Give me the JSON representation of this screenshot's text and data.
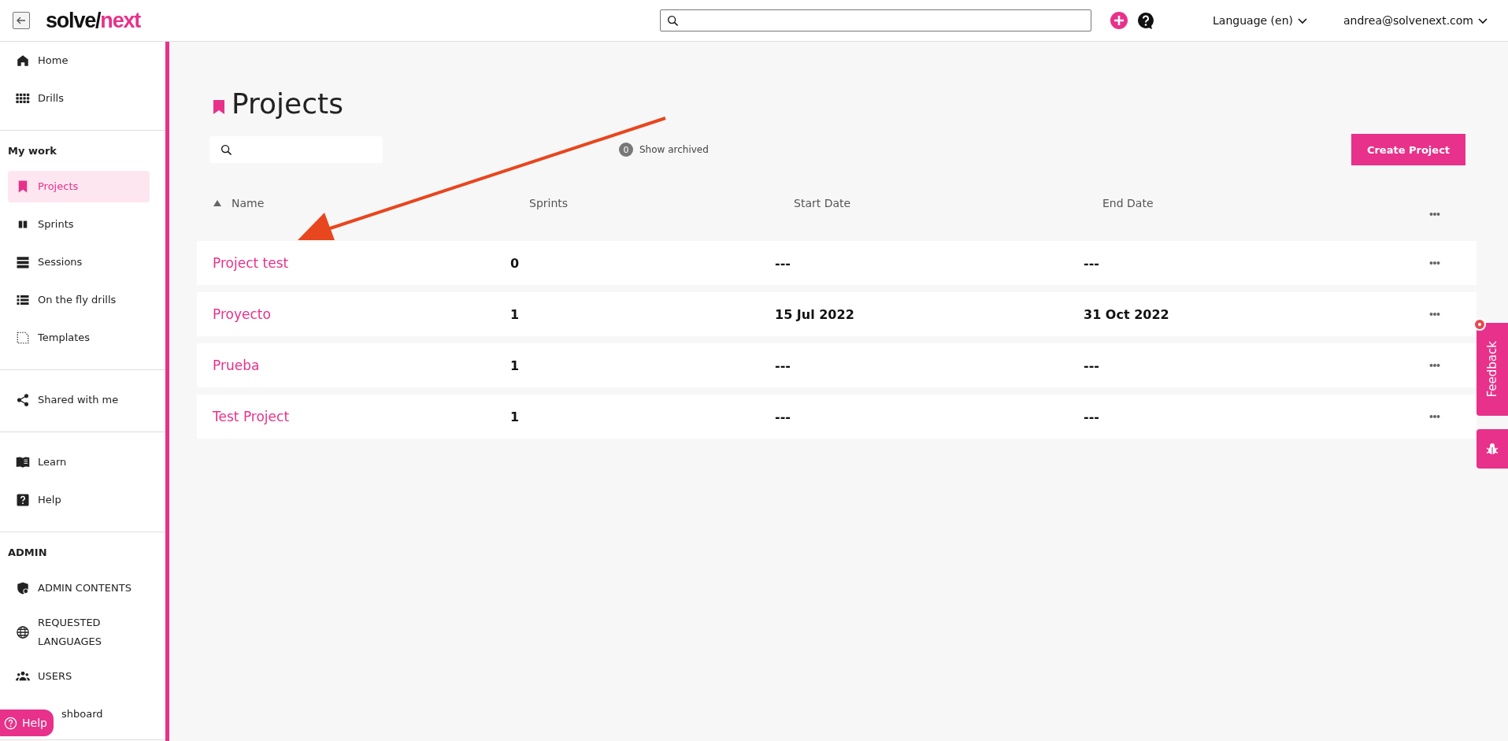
{
  "topbar": {
    "logo": {
      "first": "solve/",
      "second": "next"
    },
    "language": "Language (en)",
    "user": "andrea@solvenext.com"
  },
  "sidebar": {
    "sections": [
      {
        "items": [
          {
            "label": "Home",
            "kind": "home",
            "selected": false
          },
          {
            "label": "Drills",
            "kind": "grid",
            "selected": false
          }
        ]
      },
      {
        "heading": "My work",
        "items": [
          {
            "label": "Projects",
            "kind": "bookmark",
            "selected": true
          },
          {
            "label": "Sprints",
            "kind": "columns",
            "selected": false
          },
          {
            "label": "Sessions",
            "kind": "rows",
            "selected": false
          },
          {
            "label": "On the fly drills",
            "kind": "list",
            "selected": false
          },
          {
            "label": "Templates",
            "kind": "dashed",
            "selected": false
          }
        ]
      },
      {
        "items": [
          {
            "label": "Shared with me",
            "kind": "share",
            "selected": false
          }
        ]
      },
      {
        "items": [
          {
            "label": "Learn",
            "kind": "book",
            "selected": false
          },
          {
            "label": "Help",
            "kind": "question",
            "selected": false
          }
        ]
      },
      {
        "heading": "ADMIN",
        "items": [
          {
            "label": "ADMIN CONTENTS",
            "kind": "shield",
            "selected": false
          },
          {
            "label": "REQUESTED LANGUAGES",
            "kind": "globe",
            "selected": false
          },
          {
            "label": "USERS",
            "kind": "users",
            "selected": false
          },
          {
            "label": "shboard",
            "kind": "plain",
            "selected": false
          }
        ]
      }
    ]
  },
  "help_button": "Help",
  "page": {
    "title": "Projects",
    "archived_count": "0",
    "archived_label": "Show archived",
    "create_button": "Create Project"
  },
  "table": {
    "columns": [
      {
        "label": "Name",
        "sorted": true
      },
      {
        "label": "Sprints",
        "sorted": false
      },
      {
        "label": "Start Date",
        "sorted": false
      },
      {
        "label": "End Date",
        "sorted": false
      }
    ],
    "rows": [
      {
        "name": "Project test",
        "sprints": "0",
        "start": "---",
        "end": "---"
      },
      {
        "name": "Proyecto",
        "sprints": "1",
        "start": "15 Jul 2022",
        "end": "31 Oct 2022"
      },
      {
        "name": "Prueba",
        "sprints": "1",
        "start": "---",
        "end": "---"
      },
      {
        "name": "Test Project",
        "sprints": "1",
        "start": "---",
        "end": "---"
      }
    ]
  },
  "feedback": {
    "label": "Feedback"
  }
}
